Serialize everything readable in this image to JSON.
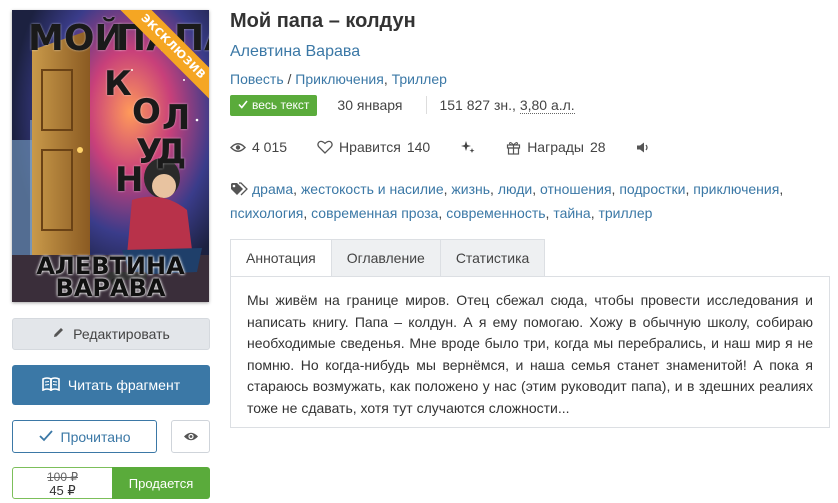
{
  "cover": {
    "ribbon": "ЭКСКЛЮЗИВ",
    "title_letters": [
      "МОЙ",
      "ПАПА",
      "К",
      "О",
      "Л",
      "Д",
      "У",
      "Н"
    ],
    "author_lines": [
      "АЛЕВТИНА",
      "ВАРАВА"
    ]
  },
  "buttons": {
    "edit": "Редактировать",
    "read": "Читать фрагмент",
    "done": "Прочитано",
    "sale": "Продается"
  },
  "price": {
    "old": "100 ₽",
    "new": "45 ₽"
  },
  "book": {
    "title": "Мой папа – колдун",
    "author": "Алевтина Варава",
    "genres": [
      "Повесть",
      "Приключения",
      "Триллер"
    ],
    "badge": "весь текст",
    "date": "30 января",
    "size_chars": "151 827 зн., ",
    "size_al": "3,80 а.л."
  },
  "stats": {
    "views": "4 015",
    "likes_label": "Нравится",
    "likes": "140",
    "awards_label": "Награды",
    "awards": "28"
  },
  "tags": [
    "драма",
    "жестокость и насилие",
    "жизнь",
    "люди",
    "отношения",
    "подростки",
    "приключения",
    "психология",
    "современная проза",
    "современность",
    "тайна",
    "триллер"
  ],
  "tabs": [
    "Аннотация",
    "Оглавление",
    "Статистика"
  ],
  "annotation": "Мы живём на границе миров. Отец сбежал сюда, чтобы провести исследования и написать книгу. Папа – колдун. А я ему помогаю. Хожу в обычную школу, собираю необходимые сведенья. Мне вроде было три, когда мы перебрались, и наш мир я не помню. Но когда-нибудь мы вернёмся, и наша семья станет знаменитой! А пока я стараюсь возмужать, как положено у нас (этим руководит папа), и в здешних реалиях тоже не сдавать, хотя тут случаются сложности...",
  "colors": {
    "accent": "#3b78a6",
    "success": "#5aab3b",
    "ribbon": "#f5a623"
  }
}
